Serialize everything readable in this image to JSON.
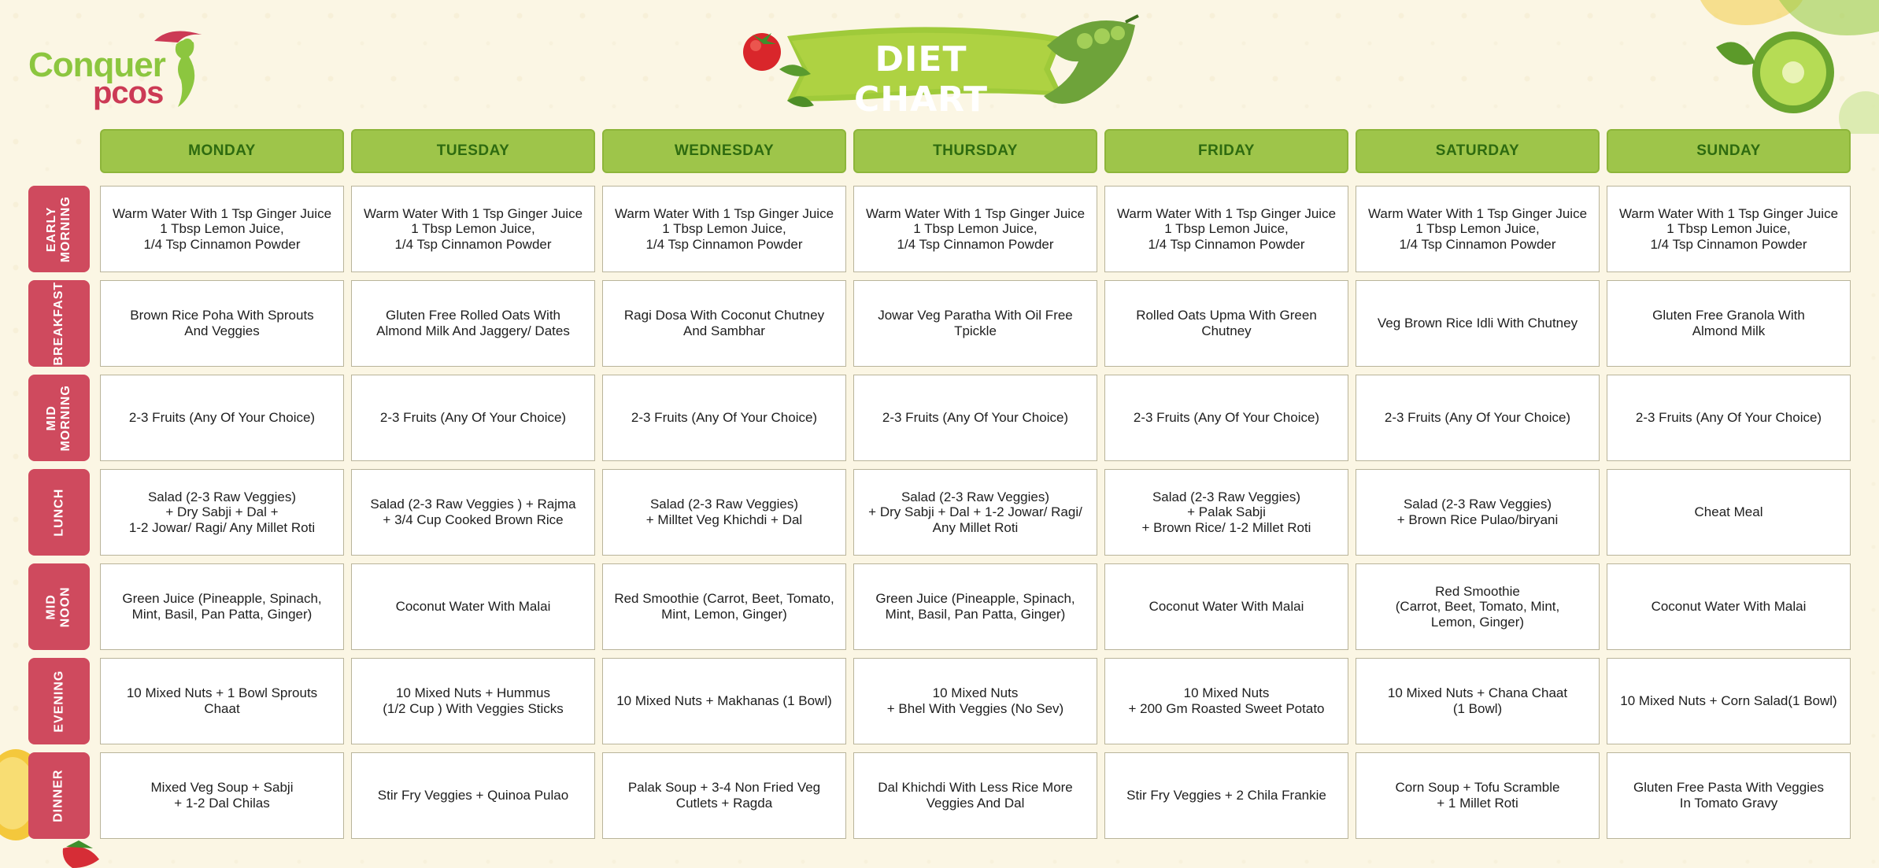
{
  "brand": {
    "line1": "Conquer",
    "line2": "pcos"
  },
  "title": "DIET CHART",
  "days": [
    "MONDAY",
    "TUESDAY",
    "WEDNESDAY",
    "THURSDAY",
    "FRIDAY",
    "SATURDAY",
    "SUNDAY"
  ],
  "meals": [
    {
      "label": "EARLY\nMORNING",
      "cells": [
        "Warm Water With 1 Tsp Ginger Juice\n1 Tbsp Lemon Juice,\n1/4 Tsp Cinnamon Powder",
        "Warm Water With 1 Tsp Ginger Juice\n1 Tbsp Lemon Juice,\n1/4 Tsp Cinnamon Powder",
        "Warm Water With 1 Tsp Ginger Juice\n1 Tbsp Lemon Juice,\n1/4 Tsp Cinnamon Powder",
        "Warm Water With 1 Tsp Ginger Juice\n1 Tbsp Lemon Juice,\n1/4 Tsp Cinnamon Powder",
        "Warm Water With 1 Tsp Ginger Juice\n1 Tbsp Lemon Juice,\n1/4 Tsp Cinnamon Powder",
        "Warm Water With 1 Tsp Ginger Juice\n1 Tbsp Lemon Juice,\n1/4 Tsp Cinnamon Powder",
        "Warm Water With 1 Tsp Ginger Juice\n1 Tbsp Lemon Juice,\n1/4 Tsp Cinnamon Powder"
      ]
    },
    {
      "label": "BREAKFAST",
      "cells": [
        "Brown Rice Poha With Sprouts\nAnd Veggies",
        "Gluten Free Rolled Oats With\nAlmond Milk And Jaggery/ Dates",
        "Ragi Dosa With Coconut Chutney\nAnd Sambhar",
        "Jowar Veg Paratha With Oil Free\nTpickle",
        "Rolled Oats Upma With Green\nChutney",
        "Veg Brown Rice Idli With Chutney",
        "Gluten Free Granola With\nAlmond Milk"
      ]
    },
    {
      "label": "MID\nMORNING",
      "cells": [
        "2-3 Fruits (Any Of Your Choice)",
        "2-3 Fruits (Any Of Your Choice)",
        "2-3 Fruits (Any Of Your Choice)",
        "2-3 Fruits (Any Of Your Choice)",
        "2-3 Fruits (Any Of Your Choice)",
        "2-3 Fruits (Any Of Your Choice)",
        "2-3 Fruits (Any Of Your Choice)"
      ]
    },
    {
      "label": "LUNCH",
      "cells": [
        "Salad (2-3 Raw Veggies)\n+ Dry Sabji + Dal +\n1-2 Jowar/ Ragi/ Any Millet Roti",
        "Salad (2-3 Raw Veggies ) + Rajma\n+ 3/4 Cup Cooked Brown Rice",
        "Salad (2-3 Raw Veggies)\n+ Milltet Veg Khichdi + Dal",
        "Salad (2-3 Raw Veggies)\n+ Dry Sabji + Dal + 1-2 Jowar/ Ragi/\nAny Millet Roti",
        "Salad (2-3 Raw Veggies)\n+ Palak Sabji\n+ Brown Rice/ 1-2 Millet Roti",
        "Salad (2-3 Raw Veggies)\n+ Brown Rice Pulao/biryani",
        "Cheat Meal"
      ]
    },
    {
      "label": "MID\nNOON",
      "cells": [
        "Green Juice (Pineapple, Spinach,\nMint, Basil, Pan Patta, Ginger)",
        "Coconut Water With Malai",
        "Red Smoothie (Carrot, Beet, Tomato,\nMint, Lemon, Ginger)",
        "Green Juice (Pineapple, Spinach,\nMint, Basil, Pan Patta, Ginger)",
        "Coconut Water With Malai",
        "Red Smoothie\n(Carrot, Beet, Tomato, Mint,\nLemon, Ginger)",
        "Coconut Water With Malai"
      ]
    },
    {
      "label": "EVENING",
      "cells": [
        "10 Mixed Nuts + 1 Bowl Sprouts\nChaat",
        "10 Mixed Nuts + Hummus\n(1/2 Cup ) With Veggies Sticks",
        "10 Mixed Nuts + Makhanas (1 Bowl)",
        "10 Mixed Nuts\n+ Bhel With Veggies (No Sev)",
        "10 Mixed Nuts\n+ 200 Gm Roasted Sweet Potato",
        "10 Mixed Nuts + Chana Chaat\n(1 Bowl)",
        "10 Mixed Nuts + Corn Salad(1 Bowl)"
      ]
    },
    {
      "label": "DINNER",
      "cells": [
        "Mixed Veg Soup + Sabji\n+ 1-2 Dal Chilas",
        "Stir Fry Veggies + Quinoa Pulao",
        "Palak Soup + 3-4 Non Fried Veg\nCutlets + Ragda",
        "Dal Khichdi With Less Rice More\nVeggies And Dal",
        "Stir Fry Veggies + 2 Chila Frankie",
        "Corn Soup + Tofu Scramble\n+ 1 Millet Roti",
        "Gluten Free Pasta With Veggies\nIn Tomato Gravy"
      ]
    }
  ],
  "colors": {
    "background": "#fbf6e4",
    "day_header": "#9ec54a",
    "day_header_text": "#2e6b10",
    "meal_label": "#cf4a5e",
    "brand_green": "#8cc63f",
    "brand_red": "#cc3a55"
  },
  "icons": [
    "woman-silhouette-logo-icon",
    "tomato-icon",
    "pea-pod-icon",
    "kiwi-icon",
    "lemon-icon",
    "strawberry-icon"
  ]
}
